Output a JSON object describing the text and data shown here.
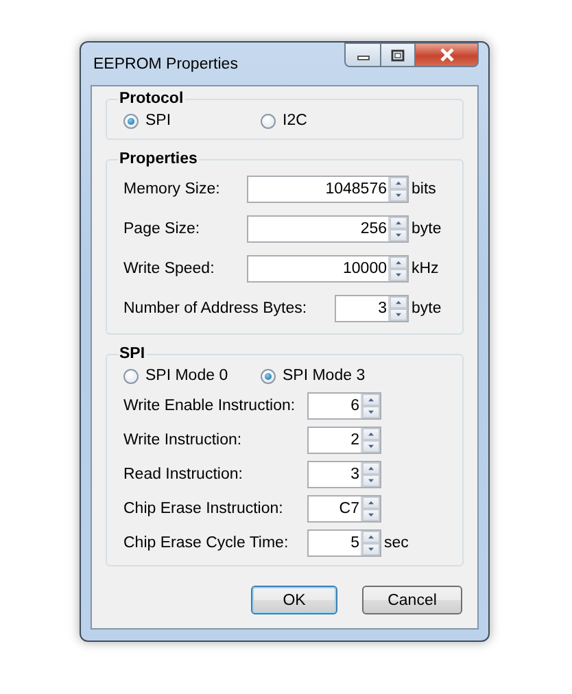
{
  "window": {
    "title": "EEPROM Properties"
  },
  "groups": [
    {
      "title": "Protocol",
      "options": [
        {
          "label": "SPI",
          "selected": true
        },
        {
          "label": "I2C",
          "selected": false
        }
      ]
    },
    {
      "title": "Properties",
      "fields": [
        {
          "label": "Memory Size:",
          "value": "1048576",
          "unit": "bits",
          "kind": "wide"
        },
        {
          "label": "Page Size:",
          "value": "256",
          "unit": "byte",
          "kind": "wide"
        },
        {
          "label": "Write Speed:",
          "value": "10000",
          "unit": "kHz",
          "kind": "wide"
        },
        {
          "label": "Number of Address Bytes:",
          "value": "3",
          "unit": "byte",
          "kind": "narrow"
        }
      ]
    },
    {
      "title": "SPI",
      "options": [
        {
          "label": "SPI Mode 0",
          "selected": false
        },
        {
          "label": "SPI Mode 3",
          "selected": true
        }
      ],
      "fields": [
        {
          "label": "Write Enable Instruction:",
          "value": "6",
          "kind": "narrow"
        },
        {
          "label": "Write Instruction:",
          "value": "2",
          "kind": "narrow"
        },
        {
          "label": "Read Instruction:",
          "value": "3",
          "kind": "narrow"
        },
        {
          "label": "Chip Erase Instruction:",
          "value": "C7",
          "kind": "narrow"
        },
        {
          "label": "Chip Erase Cycle Time:",
          "value": "5",
          "unit": "sec",
          "kind": "narrow"
        }
      ]
    }
  ],
  "buttons": [
    {
      "label": "OK",
      "default": true
    },
    {
      "label": "Cancel",
      "default": false
    }
  ]
}
